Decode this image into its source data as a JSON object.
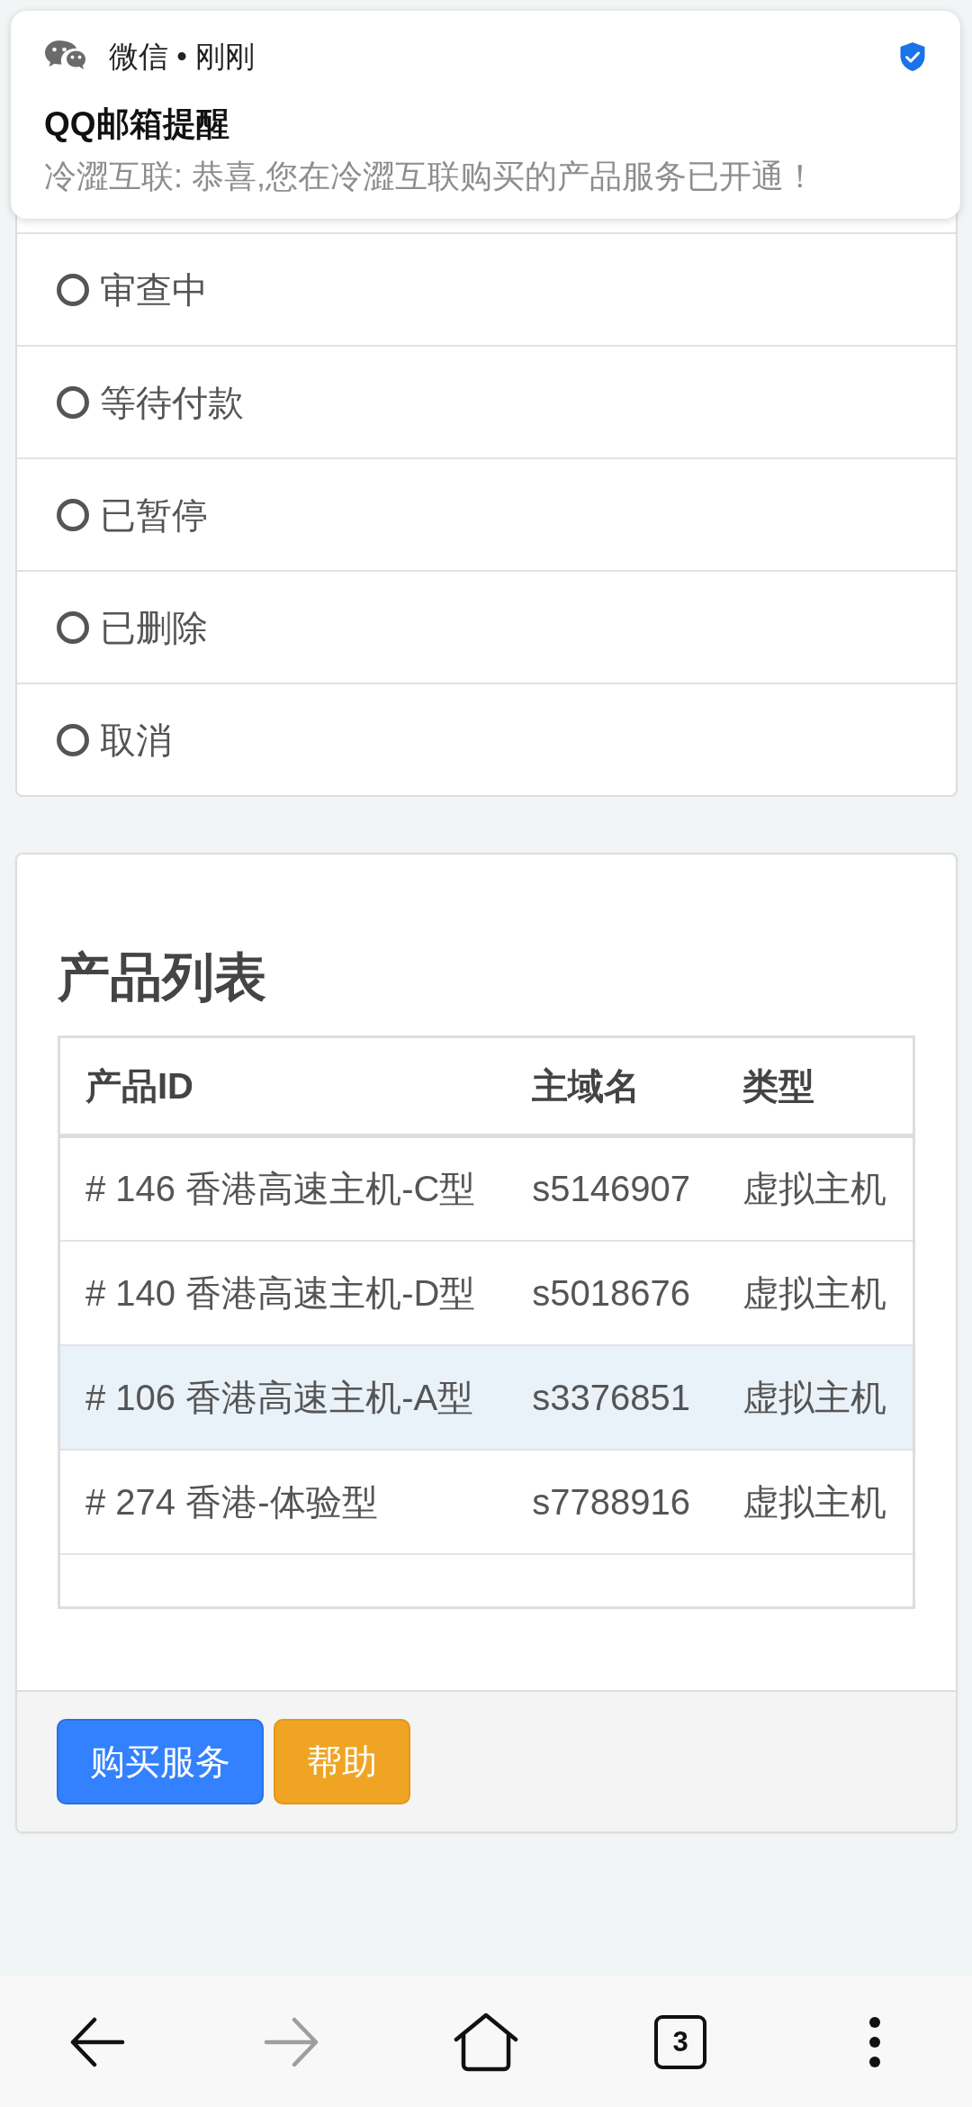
{
  "notification": {
    "app": "微信",
    "separator": "•",
    "time": "刚刚",
    "title": "QQ邮箱提醒",
    "message": "冷澀互联: 恭喜,您在冷澀互联购买的产品服务已开通！"
  },
  "status_filters": [
    {
      "label": "审查中",
      "selected": false
    },
    {
      "label": "等待付款",
      "selected": false
    },
    {
      "label": "已暂停",
      "selected": false
    },
    {
      "label": "已删除",
      "selected": false
    },
    {
      "label": "取消",
      "selected": false
    }
  ],
  "product_list": {
    "title": "产品列表",
    "table": {
      "columns": [
        "产品ID",
        "主域名",
        "类型"
      ],
      "rows": [
        {
          "cells": [
            "# 146 香港高速主机-C型",
            "s5146907",
            "虚拟主机"
          ],
          "selected": false
        },
        {
          "cells": [
            "# 140 香港高速主机-D型",
            "s5018676",
            "虚拟主机"
          ],
          "selected": false
        },
        {
          "cells": [
            "# 106 香港高速主机-A型",
            "s3376851",
            "虚拟主机"
          ],
          "selected": true
        },
        {
          "cells": [
            "# 274 香港-体验型",
            "s7788916",
            "虚拟主机"
          ],
          "selected": false
        }
      ]
    },
    "buttons": [
      {
        "label": "购买服务",
        "kind": "primary"
      },
      {
        "label": "帮助",
        "kind": "warning"
      }
    ]
  },
  "nav_bar": [
    {
      "kind": "back",
      "disabled": false
    },
    {
      "kind": "forward",
      "disabled": true
    },
    {
      "kind": "home",
      "disabled": false
    },
    {
      "kind": "tabs",
      "label": "3",
      "disabled": false
    },
    {
      "kind": "menu",
      "disabled": false
    }
  ]
}
